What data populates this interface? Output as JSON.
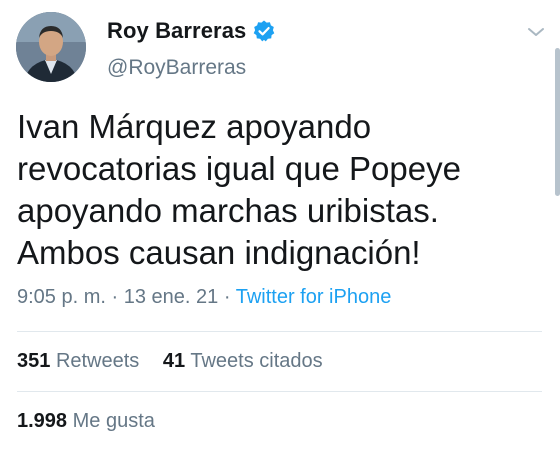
{
  "user": {
    "display_name": "Roy Barreras",
    "handle": "@RoyBarreras",
    "verified": true
  },
  "tweet": {
    "lines": [
      "Ivan Márquez apoyando",
      "revocatorias igual que Popeye",
      "apoyando marchas uribistas.",
      "Ambos causan indignación!"
    ],
    "time": "9:05 p. m.",
    "separator": "·",
    "date": "13 ene. 21",
    "source": "Twitter for iPhone"
  },
  "stats": {
    "retweets_count": "351",
    "retweets_label": "Retweets",
    "quotes_count": "41",
    "quotes_label": "Tweets citados",
    "likes_count": "1.998",
    "likes_label": "Me gusta"
  },
  "colors": {
    "accent": "#1da1f2",
    "secondary_text": "#657786",
    "divider": "#e1e8ed"
  },
  "icons": {
    "verified": "verified-badge-icon",
    "menu": "chevron-down-icon"
  }
}
